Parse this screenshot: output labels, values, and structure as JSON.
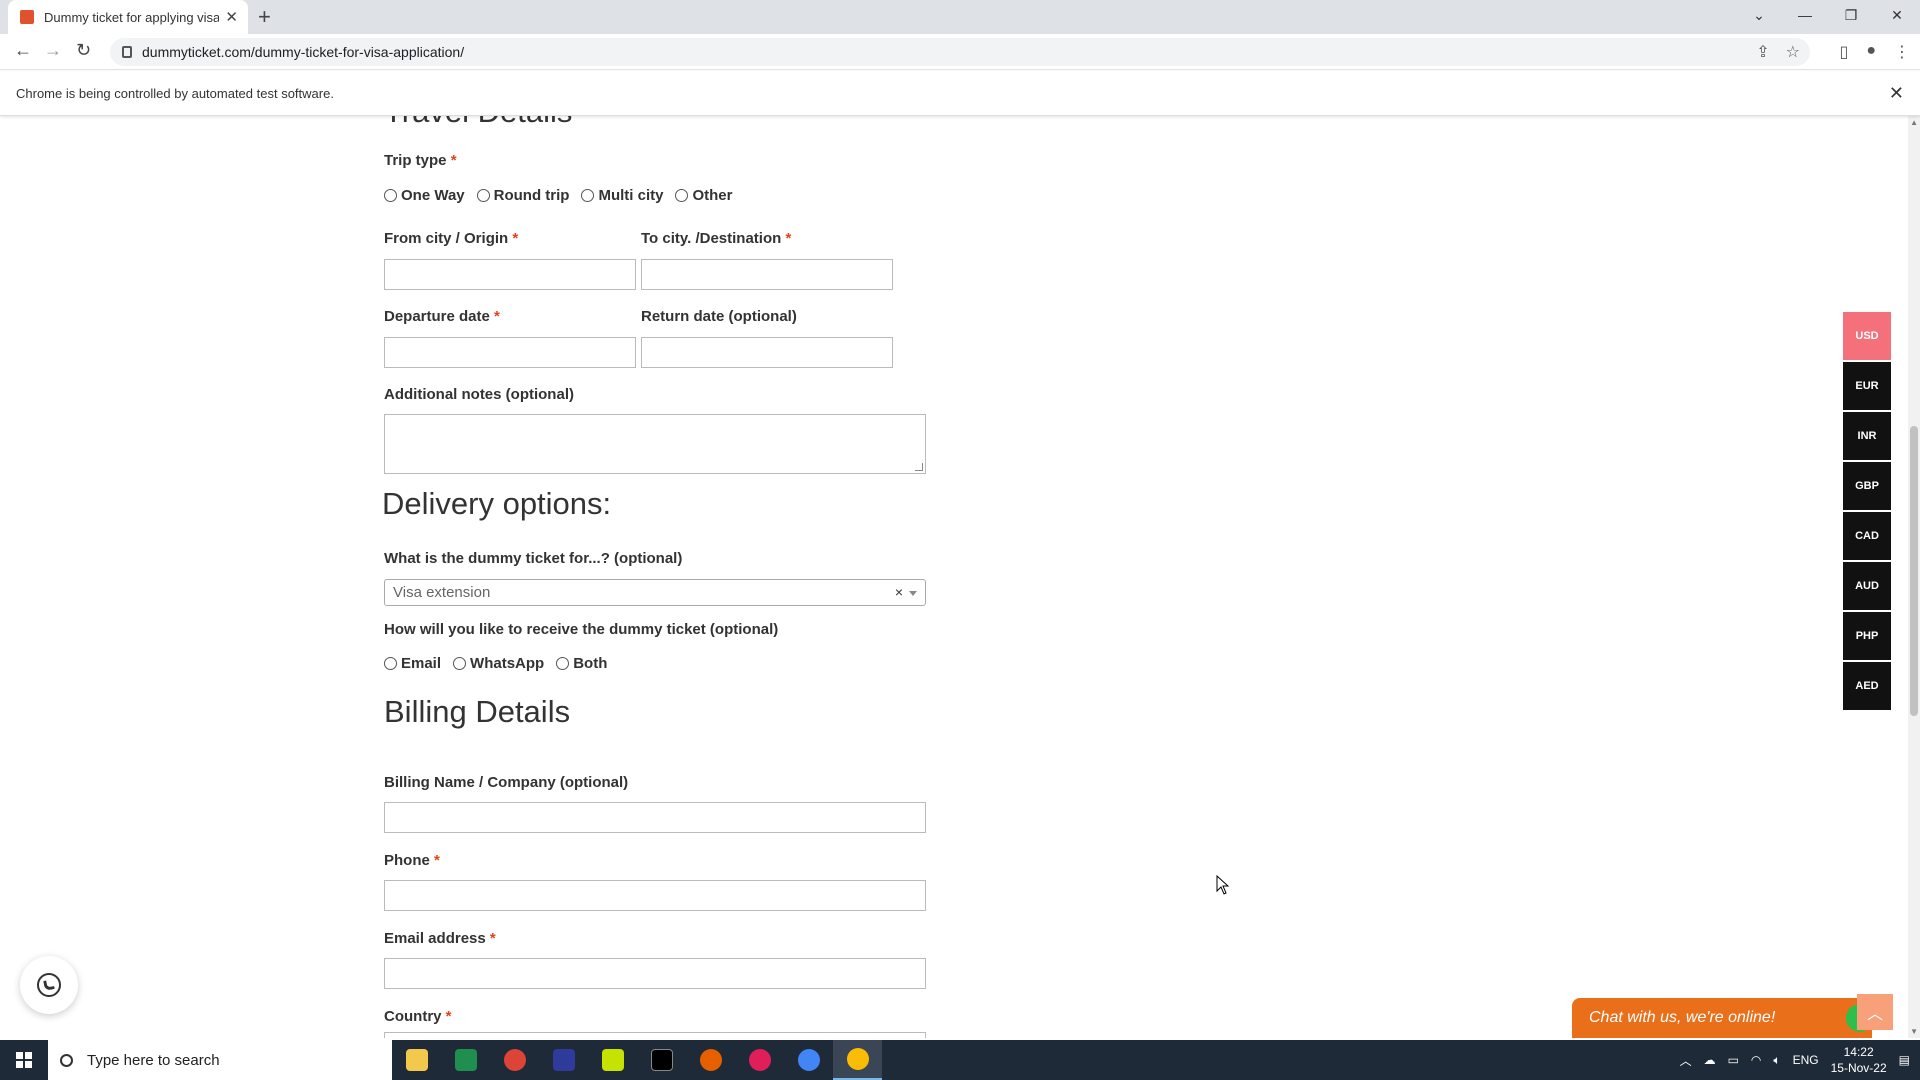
{
  "browser": {
    "tab_title": "Dummy ticket for applying visa -",
    "url": "dummyticket.com/dummy-ticket-for-visa-application/",
    "infobar": "Chrome is being controlled by automated test software."
  },
  "page": {
    "cut_heading": "Travel Details",
    "trip_type": {
      "label": "Trip type",
      "required": "*",
      "options": [
        "One Way",
        "Round trip",
        "Multi city",
        "Other"
      ]
    },
    "from_city_label": "From city / Origin",
    "to_city_label": "To city. /Destination",
    "departure_label": "Departure date",
    "return_label": "Return date (optional)",
    "notes_label": "Additional notes (optional)",
    "delivery_heading": "Delivery options:",
    "purpose_label": "What is the dummy ticket for...? (optional)",
    "purpose_value": "Visa extension",
    "purpose_clear": "×",
    "receive_label": "How will you like to receive the dummy ticket (optional)",
    "receive_options": [
      "Email",
      "WhatsApp",
      "Both"
    ],
    "billing_heading": "Billing Details",
    "billing_name_label": "Billing Name / Company (optional)",
    "phone_label": "Phone",
    "email_label": "Email address",
    "country_label": "Country",
    "required_mark": "*"
  },
  "currencies": [
    "USD",
    "EUR",
    "INR",
    "GBP",
    "CAD",
    "AUD",
    "PHP",
    "AED"
  ],
  "active_currency": "USD",
  "chat": {
    "text": "Chat with us, we're online!"
  },
  "taskbar": {
    "search_placeholder": "Type here to search",
    "lang": "ENG",
    "time": "14:22",
    "date": "15-Nov-22"
  },
  "colors": {
    "required": "#e2401c",
    "active_currency": "#f4707b",
    "chat_bg": "#ea6f1a"
  }
}
